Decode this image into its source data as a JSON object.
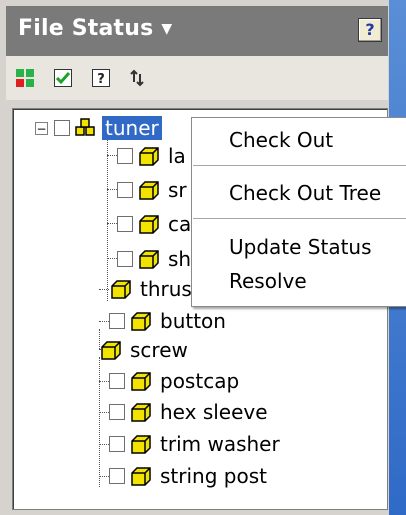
{
  "header": {
    "title": "File Status"
  },
  "help": {
    "label": "?"
  },
  "toolbar": {
    "buttons": [
      {
        "icon": "four-squares-icon"
      },
      {
        "icon": "check-icon"
      },
      {
        "icon": "question-box-icon"
      },
      {
        "icon": "refresh-arrows-icon"
      }
    ]
  },
  "tree": {
    "root": {
      "label": "tuner"
    },
    "items": [
      {
        "label": "la",
        "checkbox": true
      },
      {
        "label": "sr",
        "checkbox": true
      },
      {
        "label": "ca",
        "checkbox": true
      },
      {
        "label": "sh",
        "checkbox": true
      },
      {
        "label": "thrus",
        "checkbox": false
      },
      {
        "label": "button",
        "checkbox": true
      },
      {
        "label": "screw",
        "checkbox": false
      },
      {
        "label": "postcap",
        "checkbox": true
      },
      {
        "label": "hex sleeve",
        "checkbox": true
      },
      {
        "label": "trim washer",
        "checkbox": true
      },
      {
        "label": "string post",
        "checkbox": true
      }
    ]
  },
  "context_menu": {
    "items": [
      "Check Out",
      "Check Out Tree",
      "Update Status",
      "Resolve"
    ]
  },
  "colors": {
    "header_bg": "#7a7a7a",
    "selection": "#3169c6",
    "part_icon": "#f2e400"
  }
}
